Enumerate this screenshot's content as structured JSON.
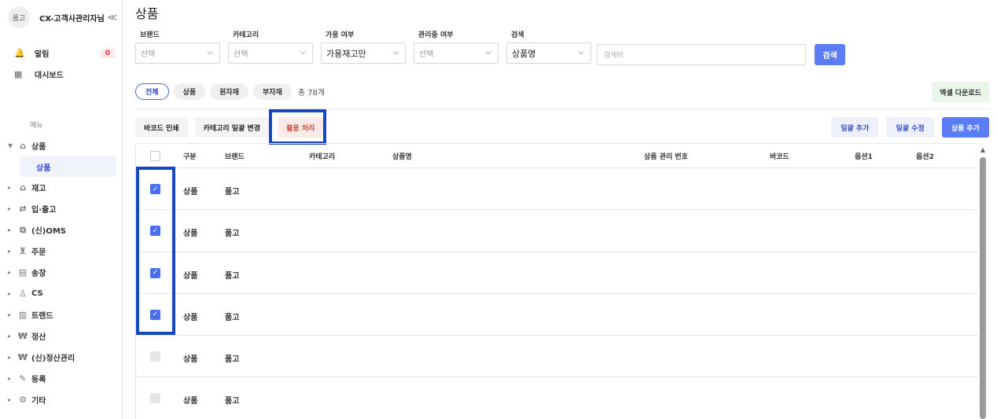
{
  "sidebar": {
    "avatar": "품고",
    "user": "CX-고객사관리자님",
    "collapse": "≪",
    "quick": [
      {
        "icon": "bell-icon",
        "glyph": "🔔",
        "label": "알림",
        "badge": "0"
      },
      {
        "icon": "dashboard-icon",
        "glyph": "▦",
        "label": "대시보드"
      }
    ],
    "menu_label": "메뉴",
    "menu": [
      {
        "key": "product",
        "label": "상품",
        "glyph": "⌂",
        "open": true
      },
      {
        "key": "stock",
        "label": "재고",
        "glyph": "⌂"
      },
      {
        "key": "inout",
        "label": "입·출고",
        "glyph": "⇄"
      },
      {
        "key": "oms",
        "label": "(신)OMS",
        "glyph": "⧉"
      },
      {
        "key": "order",
        "label": "주문",
        "glyph": "⊻"
      },
      {
        "key": "invoice",
        "label": "송장",
        "glyph": "▤"
      },
      {
        "key": "cs",
        "label": "CS",
        "glyph": "♙"
      },
      {
        "key": "trend",
        "label": "트렌드",
        "glyph": "▥"
      },
      {
        "key": "settle",
        "label": "정산",
        "glyph": "₩"
      },
      {
        "key": "new-settle",
        "label": "(신)정산관리",
        "glyph": "₩"
      },
      {
        "key": "register",
        "label": "등록",
        "glyph": "✎"
      },
      {
        "key": "etc",
        "label": "기타",
        "glyph": "⚙"
      }
    ],
    "sub_active": "상품"
  },
  "page": {
    "title": "상품"
  },
  "filters": [
    {
      "key": "brand",
      "label": "브랜드",
      "value": "선택",
      "selected": false
    },
    {
      "key": "category",
      "label": "카테고리",
      "value": "선택",
      "selected": false
    },
    {
      "key": "available",
      "label": "가용 여부",
      "value": "가용재고만",
      "selected": true
    },
    {
      "key": "managed",
      "label": "관리중 여부",
      "value": "선택",
      "selected": false
    },
    {
      "key": "search-type",
      "label": "검색",
      "value": "상품명",
      "selected": true
    }
  ],
  "search": {
    "placeholder": "검색어",
    "button": "검색"
  },
  "tabs": [
    "전체",
    "상품",
    "원자재",
    "부자재"
  ],
  "total": "총 78개",
  "excel_button": "엑셀 다운로드",
  "actions": {
    "barcode": "바코드 인쇄",
    "category_bulk": "카테고리 일괄 변경",
    "unused": "불용 처리",
    "bulk_add": "일괄 추가",
    "bulk_edit": "일괄 수정",
    "add_product": "상품 추가"
  },
  "table": {
    "headers": [
      "구분",
      "브랜드",
      "카테고리",
      "상품명",
      "상품 관리 번호",
      "바코드",
      "옵션1",
      "옵션2"
    ],
    "rows": [
      {
        "checked": true,
        "type": "상품",
        "brand": "품고"
      },
      {
        "checked": true,
        "type": "상품",
        "brand": "품고"
      },
      {
        "checked": true,
        "type": "상품",
        "brand": "품고"
      },
      {
        "checked": true,
        "type": "상품",
        "brand": "품고"
      },
      {
        "checked": false,
        "type": "상품",
        "brand": "품고"
      },
      {
        "checked": false,
        "type": "상품",
        "brand": "품고"
      }
    ]
  }
}
